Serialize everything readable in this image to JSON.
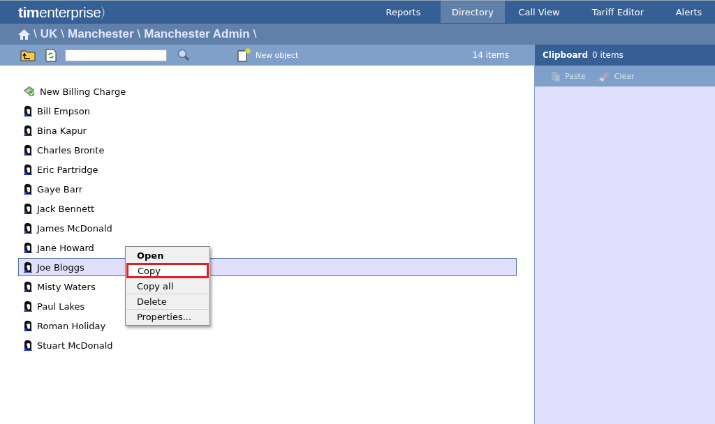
{
  "logo": {
    "bold": "tim",
    "light": "enterprise"
  },
  "nav": [
    {
      "label": "Reports",
      "selected": false
    },
    {
      "label": "Directory",
      "selected": true
    },
    {
      "label": "Call View",
      "selected": false
    },
    {
      "label": "Tariff Editor",
      "selected": false
    },
    {
      "label": "Alerts",
      "selected": false
    }
  ],
  "breadcrumb": [
    {
      "text": "\\",
      "kind": "separator"
    },
    {
      "text": "UK",
      "kind": "link"
    },
    {
      "text": "\\",
      "kind": "separator"
    },
    {
      "text": "Manchester",
      "kind": "link"
    },
    {
      "text": "\\",
      "kind": "separator"
    },
    {
      "text": "Manchester Admin",
      "kind": "link"
    },
    {
      "text": "\\",
      "kind": "separator"
    }
  ],
  "toolbar": {
    "new_object": "New object",
    "count": "14 items"
  },
  "clipboard": {
    "title": "Clipboard",
    "count": "0 items",
    "buttons": [
      {
        "label": "Paste",
        "kind": "paste",
        "disabled": true
      },
      {
        "label": "Clear",
        "kind": "clear",
        "disabled": true
      }
    ]
  },
  "items": [
    {
      "label": "New Billing Charge",
      "kind": "billing",
      "selected": false
    },
    {
      "label": "Bill Empson",
      "kind": "person",
      "selected": false
    },
    {
      "label": "Bina Kapur",
      "kind": "person",
      "selected": false
    },
    {
      "label": "Charles Bronte",
      "kind": "person",
      "selected": false
    },
    {
      "label": "Eric Partridge",
      "kind": "person",
      "selected": false
    },
    {
      "label": "Gaye Barr",
      "kind": "person",
      "selected": false
    },
    {
      "label": "Jack Bennett",
      "kind": "person",
      "selected": false
    },
    {
      "label": "James McDonald",
      "kind": "person",
      "selected": false
    },
    {
      "label": "Jane Howard",
      "kind": "person",
      "selected": false
    },
    {
      "label": "Joe Bloggs",
      "kind": "person",
      "selected": true
    },
    {
      "label": "Misty Waters",
      "kind": "person",
      "selected": false
    },
    {
      "label": "Paul Lakes",
      "kind": "person",
      "selected": false
    },
    {
      "label": "Roman Holiday",
      "kind": "person",
      "selected": false
    },
    {
      "label": "Stuart McDonald",
      "kind": "person",
      "selected": false
    }
  ],
  "context_menu": [
    {
      "label": "Open",
      "default": true,
      "highlighted": false,
      "separator": false
    },
    {
      "label": "Copy",
      "default": false,
      "highlighted": true,
      "separator": false
    },
    {
      "label": "Copy all",
      "default": false,
      "highlighted": false,
      "separator": false
    },
    {
      "label": "Delete",
      "default": false,
      "highlighted": false,
      "separator": true
    },
    {
      "label": "Properties...",
      "default": false,
      "highlighted": false,
      "separator": true
    }
  ]
}
